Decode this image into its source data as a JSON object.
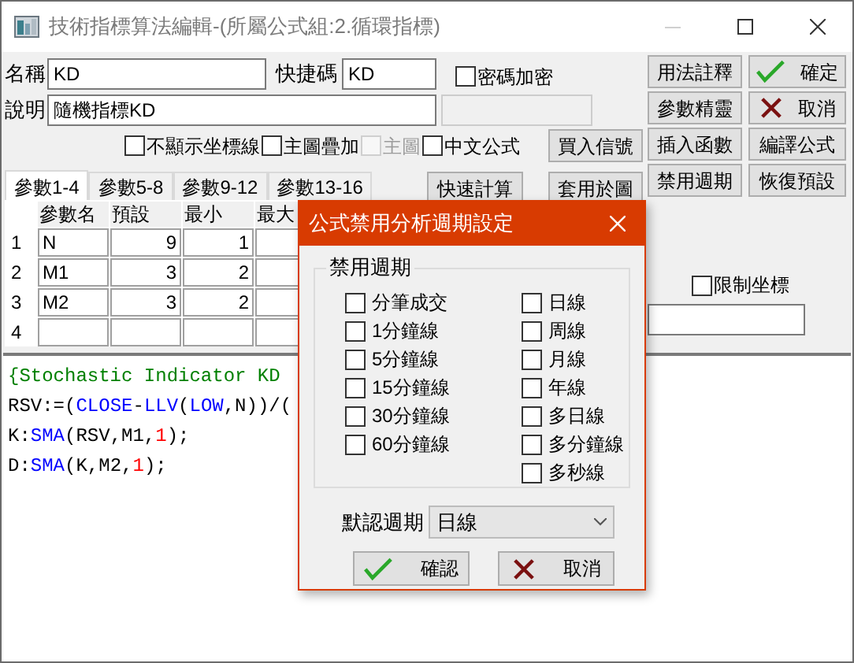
{
  "window": {
    "title": "技術指標算法編輯-(所屬公式組:2.循環指標)"
  },
  "form": {
    "name_label": "名稱",
    "name_value": "KD",
    "shortcut_label": "快捷碼",
    "shortcut_value": "KD",
    "description_label": "說明",
    "description_value": "隨機指標KD"
  },
  "password_checkbox": {
    "label": "密碼加密",
    "checked": false
  },
  "options": [
    {
      "label": "不顯示坐標線",
      "checked": false,
      "disabled": false
    },
    {
      "label": "主圖疊加",
      "checked": false,
      "disabled": false
    },
    {
      "label": "主圖",
      "checked": false,
      "disabled": true
    },
    {
      "label": "中文公式",
      "checked": false,
      "disabled": false
    }
  ],
  "side_buttons": [
    {
      "label": "用法註釋",
      "kind": "plain"
    },
    {
      "label": "確定",
      "kind": "ok"
    },
    {
      "label": "參數精靈",
      "kind": "plain"
    },
    {
      "label": "取消",
      "kind": "cancel"
    },
    {
      "label": "插入函數",
      "kind": "plain"
    },
    {
      "label": "編譯公式",
      "kind": "plain"
    },
    {
      "label": "禁用週期",
      "kind": "plain"
    },
    {
      "label": "恢復預設",
      "kind": "plain"
    }
  ],
  "buy_signal_button": "買入信號",
  "quick_calc_button": "快速計算",
  "apply_button": "套用於圖",
  "tabs": [
    {
      "label": "參數1-4",
      "selected": true
    },
    {
      "label": "參數5-8",
      "selected": false
    },
    {
      "label": "參數9-12",
      "selected": false
    },
    {
      "label": "參數13-16",
      "selected": false
    }
  ],
  "params": {
    "columns": [
      "參數名",
      "預設",
      "最小",
      "最大"
    ],
    "rows": [
      {
        "index": "1",
        "cells": [
          "N",
          "9",
          "1"
        ]
      },
      {
        "index": "2",
        "cells": [
          "M1",
          "3",
          "2"
        ]
      },
      {
        "index": "3",
        "cells": [
          "M2",
          "3",
          "2"
        ]
      },
      {
        "index": "4",
        "cells": [
          "",
          "",
          ""
        ]
      }
    ]
  },
  "limit_checkbox": {
    "label": "限制坐標",
    "checked": false
  },
  "code": [
    [
      {
        "kind": "comment",
        "text": "{Stochastic Indicator KD"
      }
    ],
    [
      {
        "kind": "plain",
        "text": "RSV:=("
      },
      {
        "kind": "function",
        "text": "CLOSE"
      },
      {
        "kind": "plain",
        "text": "-"
      },
      {
        "kind": "function",
        "text": "LLV"
      },
      {
        "kind": "plain",
        "text": "("
      },
      {
        "kind": "function",
        "text": "LOW"
      },
      {
        "kind": "plain",
        "text": ",N))/("
      }
    ],
    [
      {
        "kind": "plain",
        "text": "K:"
      },
      {
        "kind": "function",
        "text": "SMA"
      },
      {
        "kind": "plain",
        "text": "(RSV,M1,"
      },
      {
        "kind": "number",
        "text": "1"
      },
      {
        "kind": "plain",
        "text": ");"
      }
    ],
    [
      {
        "kind": "plain",
        "text": "D:"
      },
      {
        "kind": "function",
        "text": "SMA"
      },
      {
        "kind": "plain",
        "text": "(K,M2,"
      },
      {
        "kind": "number",
        "text": "1"
      },
      {
        "kind": "plain",
        "text": ");"
      }
    ]
  ],
  "dialog": {
    "title": "公式禁用分析週期設定",
    "group_label": "禁用週期",
    "left_periods": [
      {
        "label": "分筆成交",
        "checked": false
      },
      {
        "label": "1分鐘線",
        "checked": false
      },
      {
        "label": "5分鐘線",
        "checked": false
      },
      {
        "label": "15分鐘線",
        "checked": false
      },
      {
        "label": "30分鐘線",
        "checked": false
      },
      {
        "label": "60分鐘線",
        "checked": false
      }
    ],
    "right_periods": [
      {
        "label": "日線",
        "checked": false
      },
      {
        "label": "周線",
        "checked": false
      },
      {
        "label": "月線",
        "checked": false
      },
      {
        "label": "年線",
        "checked": false
      },
      {
        "label": "多日線",
        "checked": false
      },
      {
        "label": "多分鐘線",
        "checked": false
      },
      {
        "label": "多秒線",
        "checked": false
      }
    ],
    "default_label": "默認週期",
    "default_value": "日線",
    "buttons": [
      {
        "label": "確認",
        "kind": "ok"
      },
      {
        "label": "取消",
        "kind": "cancel"
      }
    ]
  }
}
